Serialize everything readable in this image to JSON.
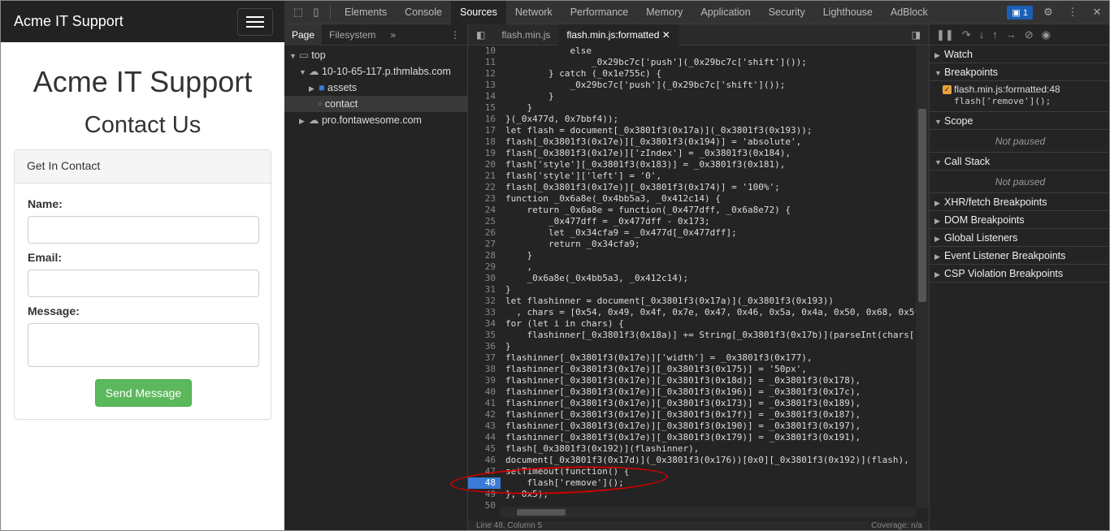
{
  "site": {
    "brand": "Acme IT Support",
    "title": "Acme IT Support",
    "subtitle": "Contact Us",
    "panel_heading": "Get In Contact",
    "name_label": "Name:",
    "email_label": "Email:",
    "message_label": "Message:",
    "send_button": "Send Message"
  },
  "devtools": {
    "main_tabs": [
      "Elements",
      "Console",
      "Sources",
      "Network",
      "Performance",
      "Memory",
      "Application",
      "Security",
      "Lighthouse",
      "AdBlock"
    ],
    "active_tab": "Sources",
    "issues_count": "1",
    "navigator": {
      "tabs": [
        "Page",
        "Filesystem"
      ],
      "tree": [
        "top",
        "10-10-65-117.p.thmlabs.com",
        "assets",
        "contact",
        "pro.fontawesome.com"
      ]
    },
    "editor": {
      "tabs": [
        "flash.min.js",
        "flash.min.js:formatted"
      ],
      "status": "Line 48, Column 5",
      "coverage": "Coverage: n/a",
      "lines": [
        {
          "n": "10",
          "t": "            else"
        },
        {
          "n": "11",
          "t": "                _0x29bc7c['push'](_0x29bc7c['shift']());"
        },
        {
          "n": "12",
          "t": "        } catch (_0x1e755c) {"
        },
        {
          "n": "13",
          "t": "            _0x29bc7c['push'](_0x29bc7c['shift']());"
        },
        {
          "n": "14",
          "t": "        }"
        },
        {
          "n": "15",
          "t": "    }"
        },
        {
          "n": "16",
          "t": "}(_0x477d, 0x7bbf4));"
        },
        {
          "n": "17",
          "t": "let flash = document[_0x3801f3(0x17a)](_0x3801f3(0x193));"
        },
        {
          "n": "18",
          "t": "flash[_0x3801f3(0x17e)][_0x3801f3(0x194)] = 'absolute',"
        },
        {
          "n": "19",
          "t": "flash[_0x3801f3(0x17e)]['zIndex'] = _0x3801f3(0x184),"
        },
        {
          "n": "20",
          "t": "flash['style'][_0x3801f3(0x183)] = _0x3801f3(0x181),"
        },
        {
          "n": "21",
          "t": "flash['style']['left'] = '0',"
        },
        {
          "n": "22",
          "t": "flash[_0x3801f3(0x17e)][_0x3801f3(0x174)] = '100%';"
        },
        {
          "n": "23",
          "t": "function _0x6a8e(_0x4bb5a3, _0x412c14) {"
        },
        {
          "n": "24",
          "t": "    return _0x6a8e = function(_0x477dff, _0x6a8e72) {"
        },
        {
          "n": "25",
          "t": "        _0x477dff = _0x477dff - 0x173;"
        },
        {
          "n": "26",
          "t": "        let _0x34cfa9 = _0x477d[_0x477dff];"
        },
        {
          "n": "27",
          "t": "        return _0x34cfa9;"
        },
        {
          "n": "28",
          "t": "    }"
        },
        {
          "n": "29",
          "t": "    ,"
        },
        {
          "n": "30",
          "t": "    _0x6a8e(_0x4bb5a3, _0x412c14);"
        },
        {
          "n": "31",
          "t": "}"
        },
        {
          "n": "32",
          "t": "let flashinner = document[_0x3801f3(0x17a)](_0x3801f3(0x193))"
        },
        {
          "n": "33",
          "t": "  , chars = [0x54, 0x49, 0x4f, 0x7e, 0x47, 0x46, 0x5a, 0x4a, 0x50, 0x68, 0x5f"
        },
        {
          "n": "34",
          "t": "for (let i in chars) {"
        },
        {
          "n": "35",
          "t": "    flashinner[_0x3801f3(0x18a)] += String[_0x3801f3(0x17b)](parseInt(chars["
        },
        {
          "n": "36",
          "t": "}"
        },
        {
          "n": "37",
          "t": "flashinner[_0x3801f3(0x17e)]['width'] = _0x3801f3(0x177),"
        },
        {
          "n": "38",
          "t": "flashinner[_0x3801f3(0x17e)][_0x3801f3(0x175)] = '50px',"
        },
        {
          "n": "39",
          "t": "flashinner[_0x3801f3(0x17e)][_0x3801f3(0x18d)] = _0x3801f3(0x178),"
        },
        {
          "n": "40",
          "t": "flashinner[_0x3801f3(0x17e)][_0x3801f3(0x196)] = _0x3801f3(0x17c),"
        },
        {
          "n": "41",
          "t": "flashinner[_0x3801f3(0x17e)][_0x3801f3(0x173)] = _0x3801f3(0x189),"
        },
        {
          "n": "42",
          "t": "flashinner[_0x3801f3(0x17e)][_0x3801f3(0x17f)] = _0x3801f3(0x187),"
        },
        {
          "n": "43",
          "t": "flashinner[_0x3801f3(0x17e)][_0x3801f3(0x190)] = _0x3801f3(0x197),"
        },
        {
          "n": "44",
          "t": "flashinner[_0x3801f3(0x17e)][_0x3801f3(0x179)] = _0x3801f3(0x191),"
        },
        {
          "n": "45",
          "t": "flash[_0x3801f3(0x192)](flashinner),"
        },
        {
          "n": "46",
          "t": "document[_0x3801f3(0x17d)](_0x3801f3(0x176))[0x0][_0x3801f3(0x192)](flash),"
        },
        {
          "n": "47",
          "t": "setTimeout(function() {"
        },
        {
          "n": "48",
          "t": "    flash['remove']();"
        },
        {
          "n": "49",
          "t": "}, 0x5);"
        },
        {
          "n": "50",
          "t": ""
        }
      ],
      "breakpoint_line": "48"
    },
    "debugger": {
      "watch": "Watch",
      "breakpoints": "Breakpoints",
      "bp_file": "flash.min.js:formatted:48",
      "bp_code": "flash['remove']();",
      "scope": "Scope",
      "not_paused": "Not paused",
      "call_stack": "Call Stack",
      "sections": [
        "XHR/fetch Breakpoints",
        "DOM Breakpoints",
        "Global Listeners",
        "Event Listener Breakpoints",
        "CSP Violation Breakpoints"
      ]
    }
  }
}
